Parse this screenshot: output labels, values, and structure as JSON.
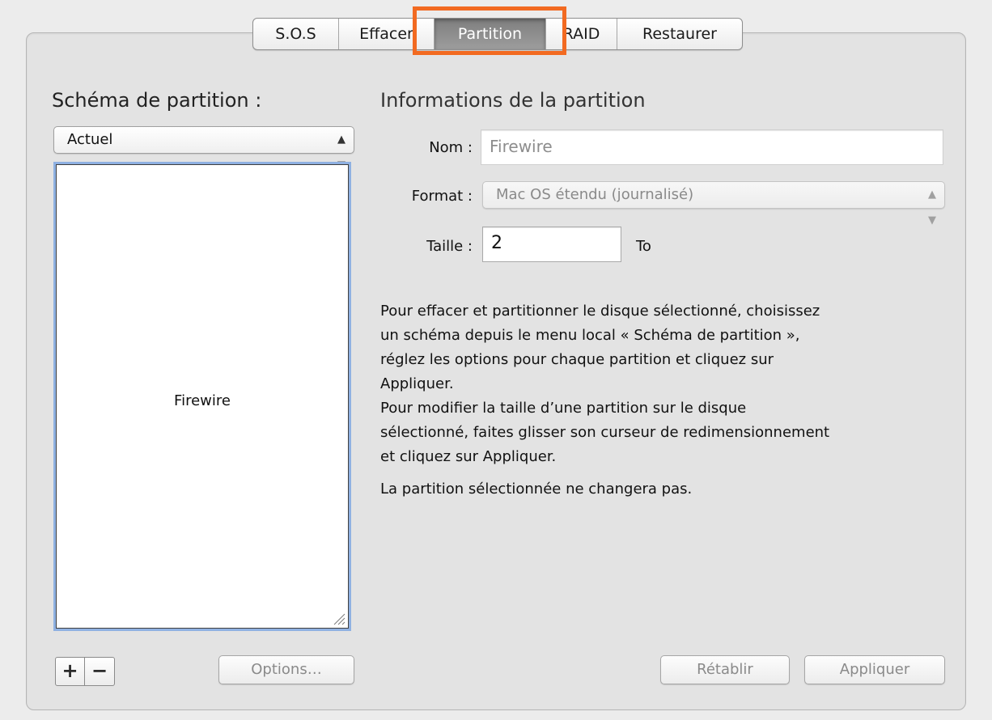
{
  "tabs": [
    {
      "label": "S.O.S",
      "active": false
    },
    {
      "label": "Effacer",
      "active": false
    },
    {
      "label": "Partition",
      "active": true
    },
    {
      "label": "RAID",
      "active": false
    },
    {
      "label": "Restaurer",
      "active": false
    }
  ],
  "highlight_color": "#f26a21",
  "scheme": {
    "title": "Schéma de partition :",
    "selected": "Actuel",
    "partition_label": "Firewire"
  },
  "info": {
    "title": "Informations de la partition",
    "name_label": "Nom :",
    "name_value": "Firewire",
    "format_label": "Format :",
    "format_value": "Mac OS étendu (journalisé)",
    "size_label": "Taille :",
    "size_value": "2",
    "size_unit": "To"
  },
  "help": {
    "text": "Pour effacer et partitionner le disque sélectionné, choisissez\nun schéma depuis le menu local « Schéma de partition »,\nréglez les options pour chaque partition et cliquez sur\nAppliquer.\nPour modifier la taille d’une partition sur le disque\nsélectionné, faites glisser son curseur de redimensionnement\net cliquez sur Appliquer.",
    "status": "La partition sélectionnée ne changera pas."
  },
  "buttons": {
    "add": "+",
    "remove": "−",
    "options": "Options…",
    "revert": "Rétablir",
    "apply": "Appliquer"
  }
}
